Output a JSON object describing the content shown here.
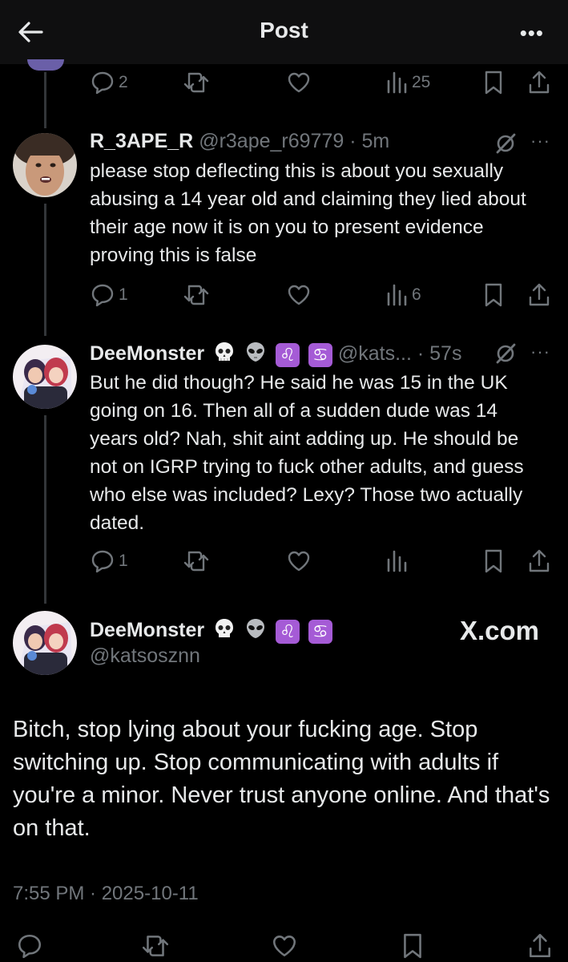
{
  "topbar": {
    "title": "Post"
  },
  "prev_tweet": {
    "stats": {
      "replies": "2",
      "views": "25"
    }
  },
  "reply1": {
    "name": "R_3APE_R",
    "meta": "@r3ape_r69779 · 5m",
    "text": "please stop deflecting this is about you sexually abusing a 14 year old and claiming they lied about their age now it is on you to present evidence proving this is false",
    "stats": {
      "replies": "1",
      "views": "6"
    }
  },
  "reply2": {
    "name": "DeeMonster",
    "meta": "@kats... · 57s",
    "emojis": [
      "💀",
      "👽",
      "♌",
      "♋"
    ],
    "text": "But he did though? He said he was 15 in the UK going on 16. Then all of a sudden dude was 14 years old? Nah, shit aint adding up. He should be not on IGRP trying to fuck other adults, and guess who else was included? Lexy? Those two actually dated.",
    "stats": {
      "replies": "1"
    }
  },
  "main": {
    "name": "DeeMonster",
    "handle": "@katsosznn",
    "watermark": "X.com",
    "text": "Bitch, stop lying about your fucking age. Stop switching up. Stop communicating with adults if you're a minor. Never trust anyone online. And that's on that.",
    "timestamp": "7:55 PM · 2025-10-11"
  },
  "colors": {
    "background": "#000000",
    "text": "#e7e9ea",
    "muted": "#71767b",
    "zodiac": "#a55bd6"
  }
}
